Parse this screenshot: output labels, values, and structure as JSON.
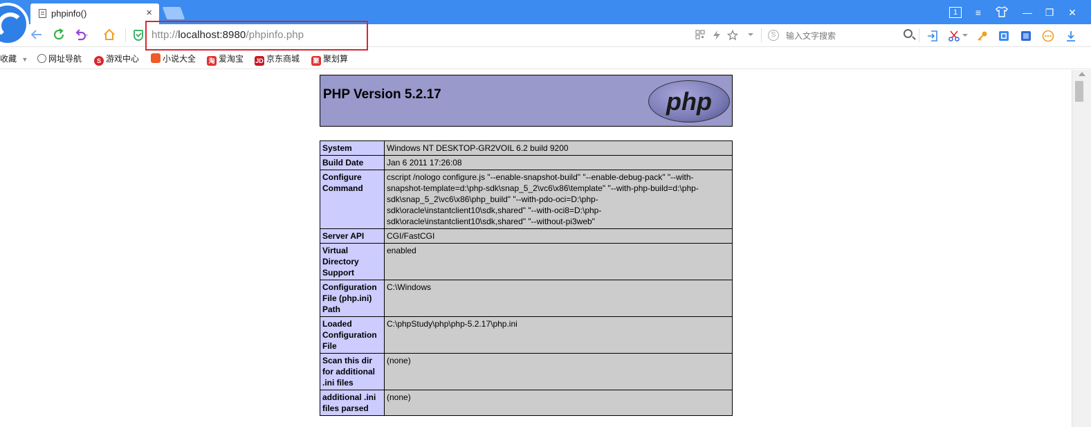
{
  "tab": {
    "title": "phpinfo()",
    "close": "×"
  },
  "window_controls": [
    "1",
    "≡",
    "👕",
    "—",
    "❐",
    "✕"
  ],
  "toolbar": {
    "url_scheme": "http://",
    "url_host": "localhost:8980",
    "url_path": "/phpinfo.php",
    "search_icon_letter": "S",
    "search_placeholder": "输入文字搜索"
  },
  "bookmarks": [
    {
      "label": "收藏",
      "icon": "",
      "icon_color": ""
    },
    {
      "label": "网址导航",
      "icon": "globe-icon",
      "icon_color": "#666666"
    },
    {
      "label": "游戏中心",
      "icon": "game-icon",
      "icon_color": "#d9262c"
    },
    {
      "label": "小说大全",
      "icon": "book-icon",
      "icon_color": "#ef5a2a"
    },
    {
      "label": "爱淘宝",
      "icon": "taobao-icon",
      "icon_color": "#e0312f"
    },
    {
      "label": "京东商城",
      "icon": "jd-icon",
      "icon_color": "#c81623"
    },
    {
      "label": "聚划算",
      "icon": "juhuasuan-icon",
      "icon_color": "#e0312f"
    }
  ],
  "php": {
    "version_title": "PHP Version 5.2.17",
    "logo_text": "php",
    "rows": [
      {
        "key": "System",
        "value": "Windows NT DESKTOP-GR2VOIL 6.2 build 9200"
      },
      {
        "key": "Build Date",
        "value": "Jan 6 2011 17:26:08"
      },
      {
        "key": "Configure Command",
        "value": "cscript /nologo configure.js \"--enable-snapshot-build\" \"--enable-debug-pack\" \"--with-snapshot-template=d:\\php-sdk\\snap_5_2\\vc6\\x86\\template\" \"--with-php-build=d:\\php-sdk\\snap_5_2\\vc6\\x86\\php_build\" \"--with-pdo-oci=D:\\php-sdk\\oracle\\instantclient10\\sdk,shared\" \"--with-oci8=D:\\php-sdk\\oracle\\instantclient10\\sdk,shared\" \"--without-pi3web\""
      },
      {
        "key": "Server API",
        "value": "CGI/FastCGI"
      },
      {
        "key": "Virtual Directory Support",
        "value": "enabled"
      },
      {
        "key": "Configuration File (php.ini) Path",
        "value": "C:\\Windows"
      },
      {
        "key": "Loaded Configuration File",
        "value": "C:\\phpStudy\\php\\php-5.2.17\\php.ini"
      },
      {
        "key": "Scan this dir for additional .ini files",
        "value": "(none)"
      },
      {
        "key": "additional .ini files parsed",
        "value": "(none)"
      }
    ]
  },
  "colors": {
    "tabstrip": "#3b8bf0",
    "php_header": "#9999cc",
    "key_cell": "#ccccff",
    "value_cell": "#cccccc",
    "highlight_outline": "#d9262c"
  }
}
